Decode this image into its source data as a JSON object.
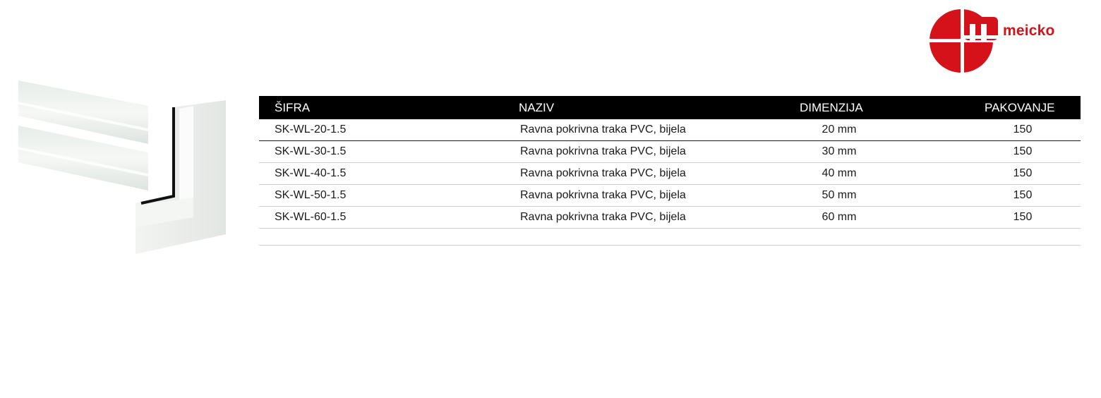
{
  "brand": {
    "name": "meicko",
    "color": "#d5121a",
    "logo_icon": "meicko-logo-icon"
  },
  "product_image": {
    "icon": "pvc-cover-strip-image"
  },
  "table": {
    "headers": {
      "code": "ŠIFRA",
      "name": "NAZIV",
      "dimension": "DIMENZIJA",
      "packaging": "PAKOVANJE"
    },
    "rows": [
      {
        "code": "SK-WL-20-1.5",
        "name": "Ravna pokrivna traka PVC, bijela",
        "dimension": "20 mm",
        "packaging": "150"
      },
      {
        "code": "SK-WL-30-1.5",
        "name": "Ravna pokrivna traka PVC, bijela",
        "dimension": "30 mm",
        "packaging": "150"
      },
      {
        "code": "SK-WL-40-1.5",
        "name": "Ravna pokrivna traka PVC, bijela",
        "dimension": "40 mm",
        "packaging": "150"
      },
      {
        "code": "SK-WL-50-1.5",
        "name": "Ravna pokrivna traka PVC, bijela",
        "dimension": "50 mm",
        "packaging": "150"
      },
      {
        "code": "SK-WL-60-1.5",
        "name": "Ravna pokrivna traka PVC, bijela",
        "dimension": "60 mm",
        "packaging": "150"
      }
    ]
  }
}
